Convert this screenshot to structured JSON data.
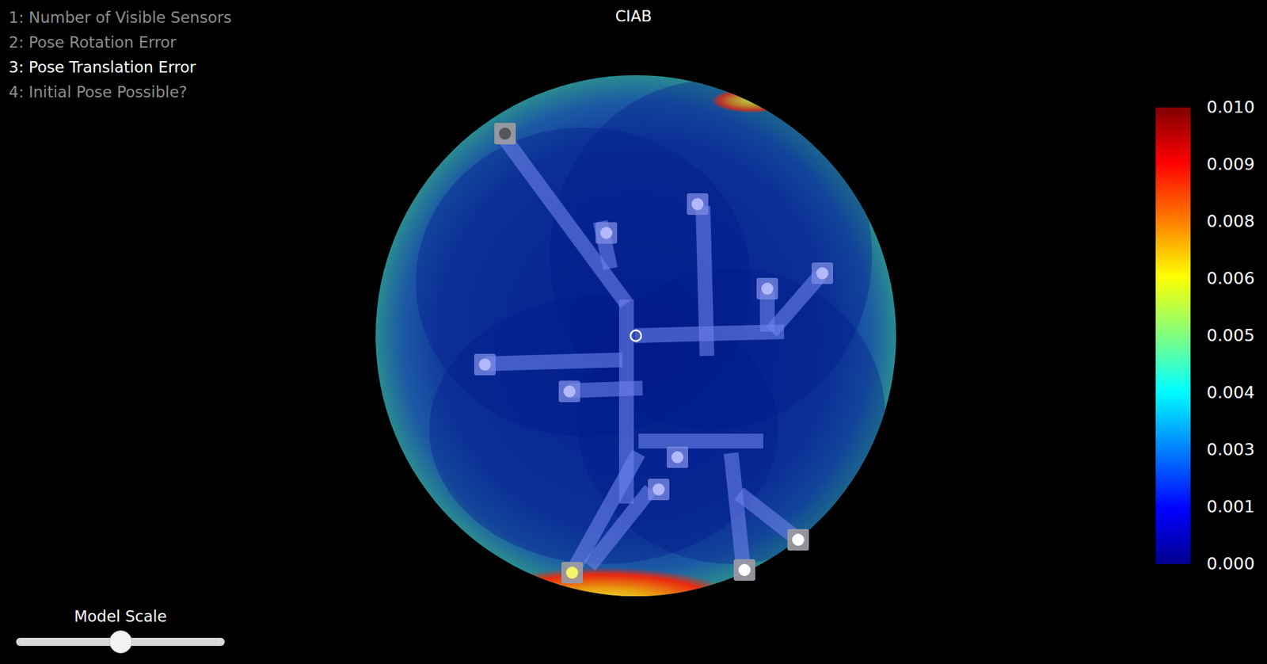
{
  "view_menu": [
    {
      "label": "1: Number of Visible Sensors",
      "selected": false
    },
    {
      "label": "2: Pose Rotation Error",
      "selected": false
    },
    {
      "label": "3: Pose Translation Error",
      "selected": true
    },
    {
      "label": "4: Initial Pose Possible?",
      "selected": false
    }
  ],
  "title": "CIAB",
  "colorbar": {
    "ticks": [
      "0.010",
      "0.009",
      "0.008",
      "0.006",
      "0.005",
      "0.004",
      "0.003",
      "0.001",
      "0.000"
    ]
  },
  "slider": {
    "label": "Model Scale",
    "level": 0.5
  }
}
